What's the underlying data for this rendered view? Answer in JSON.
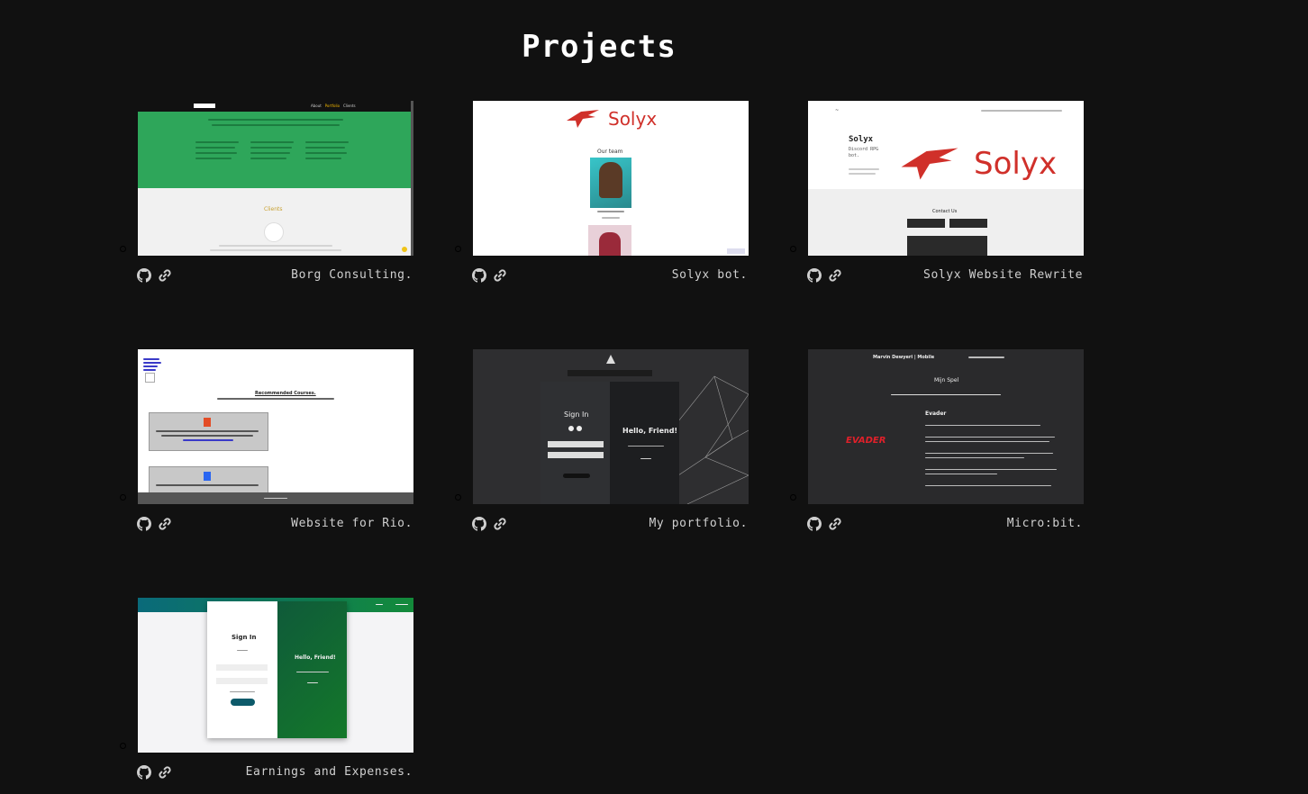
{
  "page": {
    "title": "Projects"
  },
  "projects": [
    {
      "title": "Borg Consulting.",
      "thumb": {
        "nav": [
          "About",
          "Portfolio",
          "Clients"
        ],
        "section": "Clients"
      }
    },
    {
      "title": "Solyx bot.",
      "thumb": {
        "brand": "Solyx",
        "heading": "Our team"
      }
    },
    {
      "title": "Solyx Website Rewrite",
      "thumb": {
        "brand": "Solyx",
        "name": "Solyx",
        "tagline": "Discord RPG bot.",
        "form_title": "Contact Us"
      }
    },
    {
      "title": "Website for Rio.",
      "thumb": {
        "heading": "Recommended Courses."
      }
    },
    {
      "title": "My portfolio.",
      "thumb": {
        "sign_in": "Sign In",
        "hello": "Hello, Friend!"
      }
    },
    {
      "title": "Micro:bit.",
      "thumb": {
        "header": "Marvin Dewyeri | Mobile",
        "section": "Mijn Spel",
        "game": "Evader",
        "logo": "EVADER"
      }
    },
    {
      "title": "Earnings and Expenses.",
      "thumb": {
        "sign_in": "Sign In",
        "hello": "Hello, Friend!"
      }
    }
  ],
  "icons": {
    "repo": "github-icon",
    "live": "link-icon"
  },
  "colors": {
    "background": "#111111",
    "title": "#ffffff",
    "text": "#d0d0d0",
    "accent_green": "#2ea65a",
    "accent_red": "#d0302a"
  }
}
